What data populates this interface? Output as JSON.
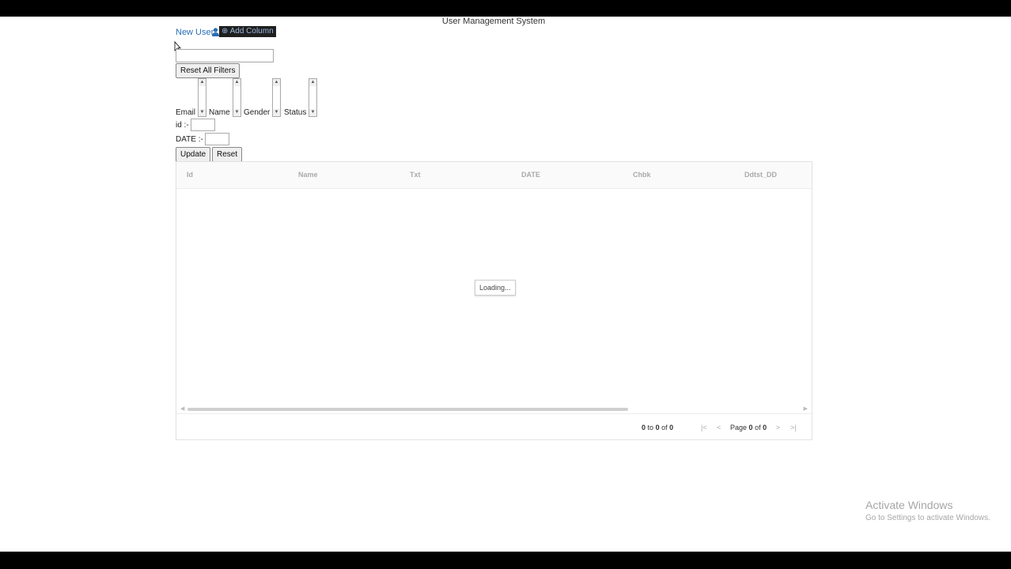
{
  "page": {
    "title": "User Management System"
  },
  "toolbar": {
    "new_user_label": "New User",
    "add_column_label": "⊕ Add Column",
    "reset_filters_label": "Reset All Filters"
  },
  "filters": {
    "email_label": "Email",
    "name_label": "Name",
    "gender_label": "Gender",
    "status_label": "Status",
    "id_label": "id :-",
    "date_label": "DATE :-"
  },
  "actions": {
    "update_label": "Update",
    "reset_label": "Reset"
  },
  "grid": {
    "columns": [
      "Id",
      "Name",
      "Txt",
      "DATE",
      "Chbk",
      "Ddtst_DD"
    ],
    "loading_text": "Loading...",
    "pager": {
      "from": "0",
      "to_word": "to",
      "to": "0",
      "of_word": "of",
      "total": "0",
      "page_word": "Page",
      "page": "0",
      "pages": "0"
    }
  },
  "os": {
    "watermark_title": "Activate Windows",
    "watermark_sub": "Go to Settings to activate Windows."
  },
  "colors": {
    "link": "#2a6db5",
    "highlight_bg": "#1f1f1f",
    "highlight_text": "#9ab7de"
  }
}
